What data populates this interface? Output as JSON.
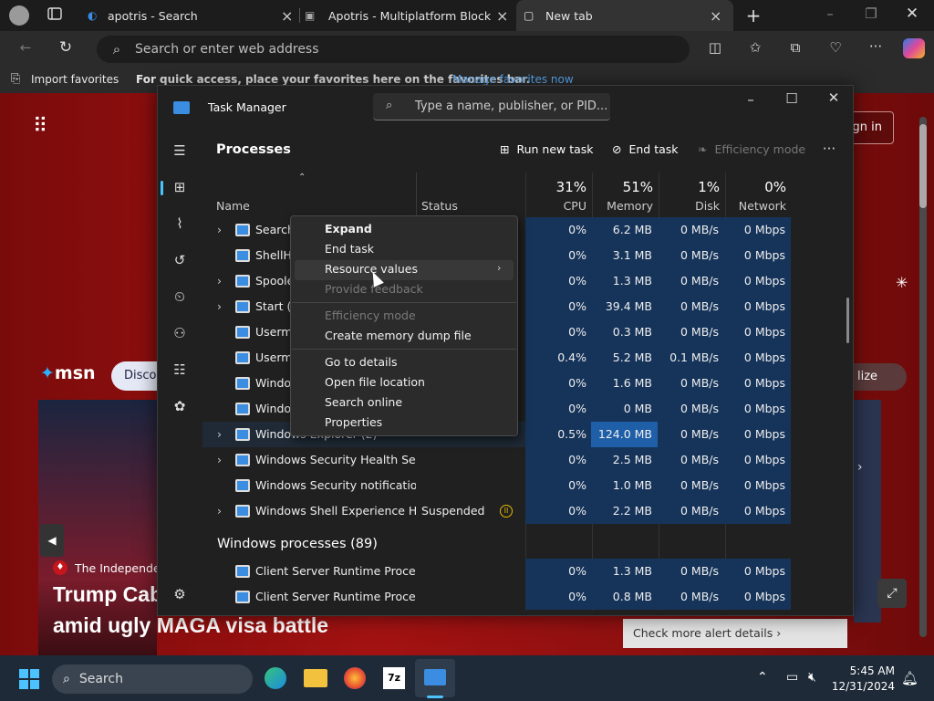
{
  "browser": {
    "tabs": [
      {
        "label": "apotris - Search"
      },
      {
        "label": "Apotris - Multiplatform Block Sta"
      },
      {
        "label": "New tab"
      }
    ],
    "address_placeholder": "Search or enter web address",
    "favbar": {
      "import_label": "Import favorites",
      "hint": "For quick access, place your favorites here on the favorites bar.",
      "manage_link": "Manage favorites now"
    }
  },
  "page": {
    "signin": "Sign in",
    "msn": "msn",
    "discover": "Discov",
    "personalize": "lize",
    "source": "The Independent",
    "headline_1": "Trump Cab",
    "headline_2": "amid ugly MAGA visa battle",
    "alert_link": "Check more alert details"
  },
  "taskmanager": {
    "title": "Task Manager",
    "search_placeholder": "Type a name, publisher, or PID...",
    "section_title": "Processes",
    "toolbar": {
      "run_new_task": "Run new task",
      "end_task": "End task",
      "efficiency_mode": "Efficiency mode"
    },
    "columns": {
      "name": "Name",
      "status": "Status",
      "cpu_pct": "31%",
      "cpu": "CPU",
      "mem_pct": "51%",
      "memory": "Memory",
      "disk_pct": "1%",
      "disk": "Disk",
      "net_pct": "0%",
      "network": "Network"
    },
    "rows": [
      {
        "name": "Search",
        "status": "",
        "cpu": "0%",
        "mem": "6.2 MB",
        "disk": "0 MB/s",
        "net": "0 Mbps"
      },
      {
        "name": "ShellHo",
        "status": "",
        "cpu": "0%",
        "mem": "3.1 MB",
        "disk": "0 MB/s",
        "net": "0 Mbps"
      },
      {
        "name": "Spooler",
        "status": "",
        "cpu": "0%",
        "mem": "1.3 MB",
        "disk": "0 MB/s",
        "net": "0 Mbps"
      },
      {
        "name": "Start (2)",
        "status": "",
        "cpu": "0%",
        "mem": "39.4 MB",
        "disk": "0 MB/s",
        "net": "0 Mbps"
      },
      {
        "name": "Usermo",
        "status": "",
        "cpu": "0%",
        "mem": "0.3 MB",
        "disk": "0 MB/s",
        "net": "0 Mbps"
      },
      {
        "name": "Usermo",
        "status": "",
        "cpu": "0.4%",
        "mem": "5.2 MB",
        "disk": "0.1 MB/s",
        "net": "0 Mbps"
      },
      {
        "name": "Window",
        "status": "",
        "cpu": "0%",
        "mem": "1.6 MB",
        "disk": "0 MB/s",
        "net": "0 Mbps"
      },
      {
        "name": "Window",
        "status": "",
        "cpu": "0%",
        "mem": "0 MB",
        "disk": "0 MB/s",
        "net": "0 Mbps"
      },
      {
        "name": "Windows Explorer (2)",
        "status": "",
        "cpu": "0.5%",
        "mem": "124.0 MB",
        "disk": "0 MB/s",
        "net": "0 Mbps"
      },
      {
        "name": "Windows Security Health Servi...",
        "status": "",
        "cpu": "0%",
        "mem": "2.5 MB",
        "disk": "0 MB/s",
        "net": "0 Mbps"
      },
      {
        "name": "Windows Security notification...",
        "status": "",
        "cpu": "0%",
        "mem": "1.0 MB",
        "disk": "0 MB/s",
        "net": "0 Mbps"
      },
      {
        "name": "Windows Shell Experience Hos...",
        "status": "Suspended",
        "cpu": "0%",
        "mem": "2.2 MB",
        "disk": "0 MB/s",
        "net": "0 Mbps"
      }
    ],
    "group_title": "Windows processes (89)",
    "group_rows": [
      {
        "name": "Client Server Runtime Process",
        "cpu": "0%",
        "mem": "1.3 MB",
        "disk": "0 MB/s",
        "net": "0 Mbps"
      },
      {
        "name": "Client Server Runtime Process",
        "cpu": "0%",
        "mem": "0.8 MB",
        "disk": "0 MB/s",
        "net": "0 Mbps"
      }
    ]
  },
  "context_menu": {
    "expand": "Expand",
    "end_task": "End task",
    "resource_values": "Resource values",
    "provide_feedback": "Provide feedback",
    "efficiency_mode": "Efficiency mode",
    "create_dump": "Create memory dump file",
    "go_to_details": "Go to details",
    "open_file_location": "Open file location",
    "search_online": "Search online",
    "properties": "Properties"
  },
  "taskbar": {
    "search": "Search",
    "time": "5:45 AM",
    "date": "12/31/2024"
  },
  "colors": {
    "accent": "#0078d4",
    "highlight": "#16345a",
    "brand_red": "#a31212"
  }
}
